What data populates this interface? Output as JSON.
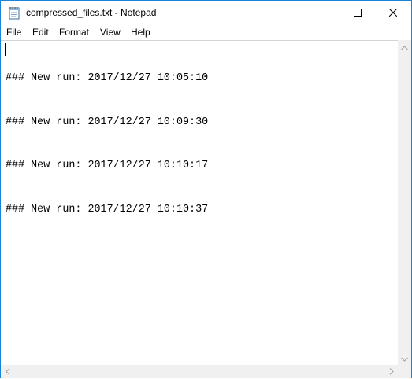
{
  "window": {
    "title": "compressed_files.txt - Notepad",
    "border_color": "#1883d7"
  },
  "menubar": {
    "items": [
      {
        "label": "File"
      },
      {
        "label": "Edit"
      },
      {
        "label": "Format"
      },
      {
        "label": "View"
      },
      {
        "label": "Help"
      }
    ]
  },
  "editor": {
    "lines": [
      "### New run: 2017/12/27 10:05:10",
      "### New run: 2017/12/27 10:09:30",
      "### New run: 2017/12/27 10:10:17",
      "### New run: 2017/12/27 10:10:37"
    ]
  },
  "icons": {
    "app": "notepad-icon",
    "minimize": "minimize-icon",
    "maximize": "maximize-icon",
    "close": "close-icon",
    "scroll_up": "chevron-up-icon",
    "scroll_down": "chevron-down-icon",
    "scroll_left": "chevron-left-icon",
    "scroll_right": "chevron-right-icon"
  }
}
